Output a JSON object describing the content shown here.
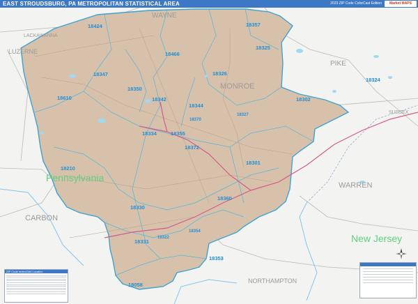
{
  "title": "EAST STROUDSBURG, PA METROPOLITAN STATISTICAL AREA",
  "edition": "2023 ZIP Code ColorCast Edition",
  "logo": "Market MAPS",
  "map": {
    "county_labels": [
      {
        "text": "WAYNE"
      },
      {
        "text": "LACKAWANNA"
      },
      {
        "text": "LUZERNE"
      },
      {
        "text": "PIKE"
      },
      {
        "text": "MONROE"
      },
      {
        "text": "SUSSEX"
      },
      {
        "text": "WARREN"
      },
      {
        "text": "CARBON"
      },
      {
        "text": "NORTHAMPTON"
      }
    ],
    "state_labels": [
      {
        "text": "Pennsylvania"
      },
      {
        "text": "New Jersey"
      }
    ],
    "zip_labels": [
      {
        "text": "18424"
      },
      {
        "text": "18357"
      },
      {
        "text": "18325"
      },
      {
        "text": "18466"
      },
      {
        "text": "18347"
      },
      {
        "text": "18326"
      },
      {
        "text": "18324"
      },
      {
        "text": "18610"
      },
      {
        "text": "18350"
      },
      {
        "text": "18342"
      },
      {
        "text": "18344"
      },
      {
        "text": "18302"
      },
      {
        "text": "18370"
      },
      {
        "text": "18327"
      },
      {
        "text": "18334"
      },
      {
        "text": "18355"
      },
      {
        "text": "18372"
      },
      {
        "text": "18301"
      },
      {
        "text": "18210"
      },
      {
        "text": "18330"
      },
      {
        "text": "18360"
      },
      {
        "text": "18354"
      },
      {
        "text": "18331"
      },
      {
        "text": "18322"
      },
      {
        "text": "18353"
      },
      {
        "text": "18058"
      }
    ],
    "colors": {
      "metro_fill": "#d8c1ab",
      "metro_border": "#3fa2d0",
      "background": "#f3f3f1",
      "water": "#9fd8f0",
      "highway": "#d45a8a",
      "zip_label": "#1f8fd6",
      "state_label": "#5fd07c",
      "title_bar": "#3c78c6"
    }
  },
  "legend": {
    "header": "ZIP Code Index/Grid Location"
  },
  "icons": [
    "compass-rose-icon",
    "city-logo-icon"
  ]
}
